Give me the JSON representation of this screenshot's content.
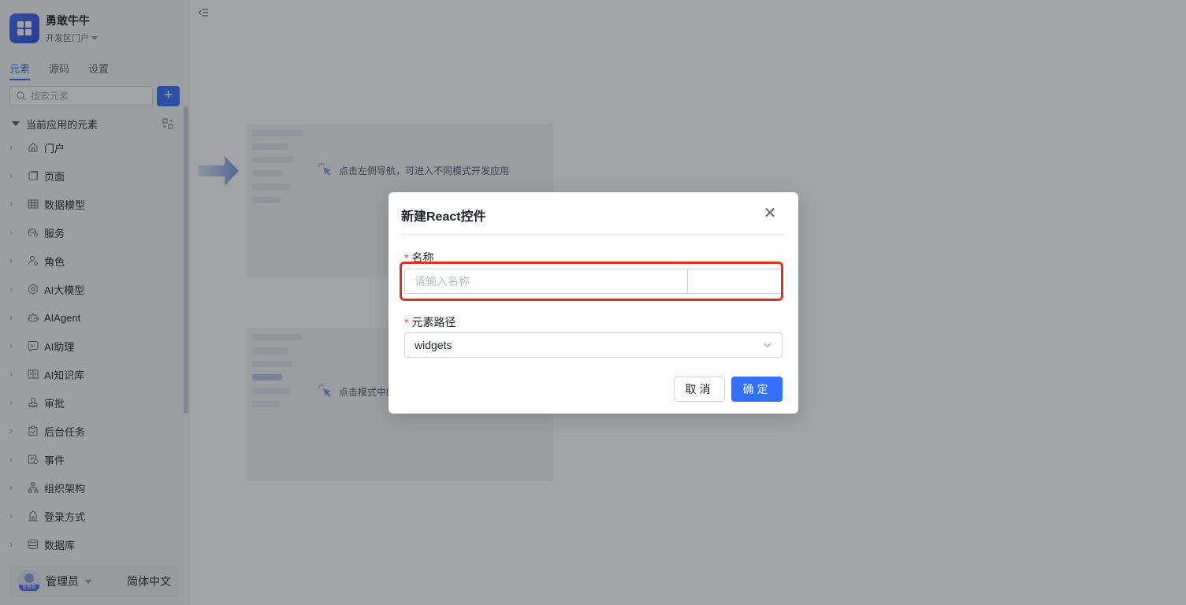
{
  "app": {
    "name": "勇敢牛牛",
    "portal": "开发区门户"
  },
  "tabs": [
    {
      "label": "元素",
      "active": true
    },
    {
      "label": "源码",
      "active": false
    },
    {
      "label": "设置",
      "active": false
    }
  ],
  "search": {
    "placeholder": "搜索元素"
  },
  "add_label": "+",
  "tree": {
    "header": "当前应用的元素",
    "items": [
      {
        "label": "门户",
        "icon": "home-icon"
      },
      {
        "label": "页面",
        "icon": "page-icon"
      },
      {
        "label": "数据模型",
        "icon": "table-icon"
      },
      {
        "label": "服务",
        "icon": "service-icon"
      },
      {
        "label": "角色",
        "icon": "role-icon"
      },
      {
        "label": "AI大模型",
        "icon": "ai-model-icon"
      },
      {
        "label": "AIAgent",
        "icon": "robot-icon"
      },
      {
        "label": "AI助理",
        "icon": "ai-assistant-icon"
      },
      {
        "label": "AI知识库",
        "icon": "book-icon"
      },
      {
        "label": "审批",
        "icon": "stamp-icon"
      },
      {
        "label": "后台任务",
        "icon": "task-icon"
      },
      {
        "label": "事件",
        "icon": "event-icon"
      },
      {
        "label": "组织架构",
        "icon": "org-icon"
      },
      {
        "label": "登录方式",
        "icon": "login-icon"
      },
      {
        "label": "数据库",
        "icon": "database-icon"
      }
    ]
  },
  "user": {
    "name": "管理员",
    "avatar_tag": "管理员",
    "language": "简体中文"
  },
  "guides": [
    {
      "text": "点击左侧导航，可进入不同模式开发应用"
    },
    {
      "text": "点击模式中的树"
    }
  ],
  "dialog": {
    "title": "新建React控件",
    "close": "✕",
    "name_label": "名称",
    "name_placeholder": "请输入名称",
    "name_value": "",
    "path_label": "元素路径",
    "path_value": "widgets",
    "required_mark": "*",
    "cancel": "取消",
    "confirm": "确定"
  },
  "colors": {
    "primary": "#3370ff",
    "highlight": "#e0301e",
    "required": "#f54a45"
  }
}
